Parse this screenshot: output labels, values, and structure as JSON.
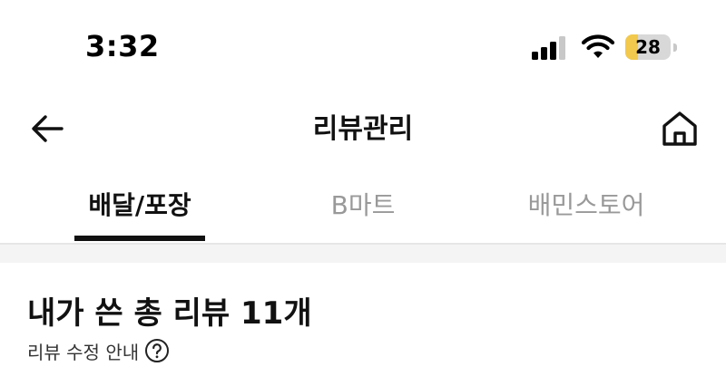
{
  "status_bar": {
    "time": "3:32",
    "battery_level": "28",
    "battery_fraction": 0.28,
    "icons": [
      "cellular-signal-icon",
      "wifi-icon",
      "battery-icon"
    ],
    "battery_fill_color": "#f2c94c"
  },
  "nav_bar": {
    "title": "리뷰관리",
    "left_icon": "arrow-left-icon",
    "right_icon": "home-icon"
  },
  "tabs": [
    {
      "label": "배달/포장",
      "active": true
    },
    {
      "label": "B마트",
      "active": false
    },
    {
      "label": "배민스토어",
      "active": false
    }
  ],
  "content": {
    "review_total": "내가 쓴 총 리뷰 11개",
    "review_guide": "리뷰 수정 안내",
    "review_guide_icon": "question-circle-icon"
  }
}
